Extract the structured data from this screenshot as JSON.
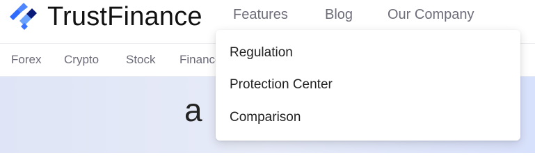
{
  "brand": {
    "name": "TrustFinance",
    "logo_icon": "trustfinance-logo-icon",
    "colors": [
      "#2f6bff",
      "#4d86ff",
      "#6aa2ff",
      "#0a1a7a"
    ]
  },
  "top_nav": {
    "items": [
      {
        "label": "Features"
      },
      {
        "label": "Blog"
      },
      {
        "label": "Our Company"
      }
    ]
  },
  "sub_nav": {
    "items": [
      {
        "label": "Forex"
      },
      {
        "label": "Crypto"
      },
      {
        "label": "Stock"
      },
      {
        "label": "Finance"
      }
    ]
  },
  "dropdown": {
    "items": [
      {
        "label": "Regulation"
      },
      {
        "label": "Protection Center"
      },
      {
        "label": "Comparison"
      }
    ]
  },
  "hero": {
    "heading_visible": "a"
  }
}
